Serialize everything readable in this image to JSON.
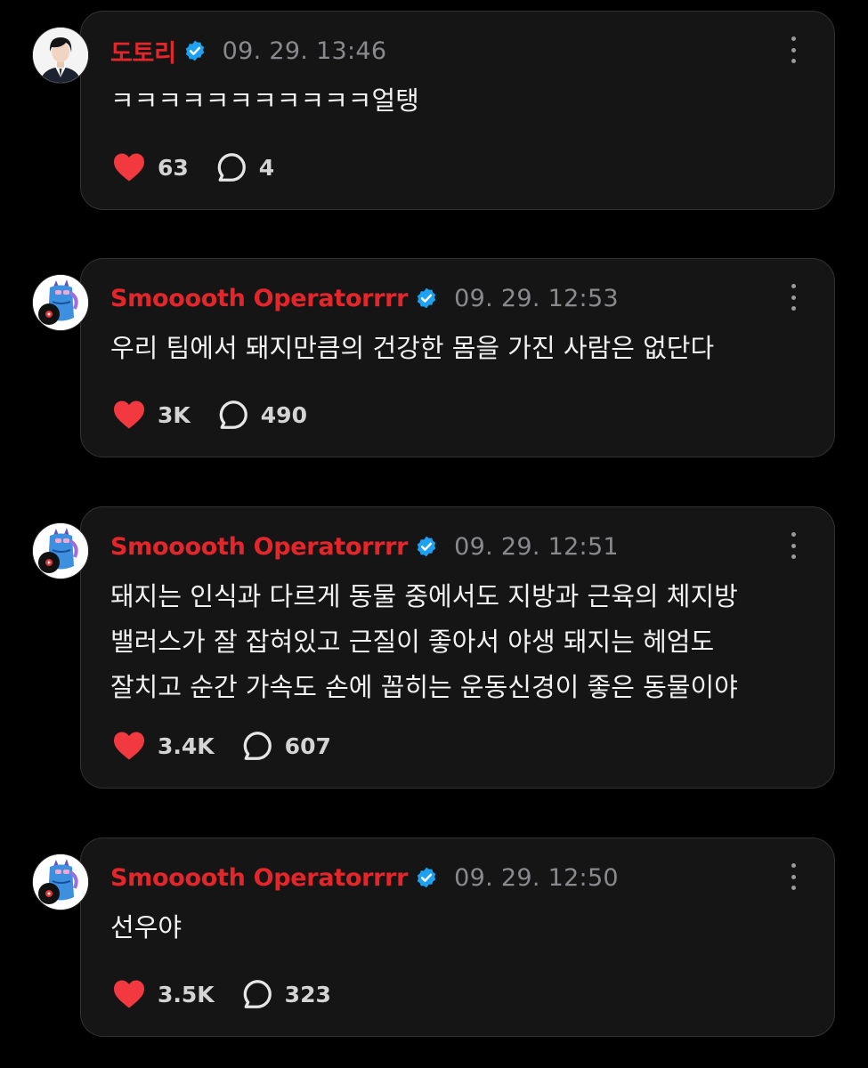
{
  "posts": [
    {
      "author": "도토리",
      "verified": true,
      "time": "09. 29. 13:46",
      "text": "ㅋㅋㅋㅋㅋㅋㅋㅋㅋㅋㅋ얼탱",
      "likes": "63",
      "replies": "4",
      "avatar_icon": "person-photo-avatar"
    },
    {
      "author": "Smooooth Operatorrrr",
      "verified": true,
      "time": "09. 29. 12:53",
      "text": "우리 팀에서 돼지만큼의 건강한 몸을 가진 사람은 없단다",
      "likes": "3K",
      "replies": "490",
      "avatar_icon": "blue-character-avatar"
    },
    {
      "author": "Smooooth Operatorrrr",
      "verified": true,
      "time": "09. 29. 12:51",
      "text": "돼지는 인식과 다르게 동물 중에서도 지방과 근육의 체지방\n밸러스가 잘 잡혀있고 근질이 좋아서 야생 돼지는 헤엄도\n잘치고 순간 가속도 손에 꼽히는 운동신경이 좋은 동물이야",
      "likes": "3.4K",
      "replies": "607",
      "avatar_icon": "blue-character-avatar"
    },
    {
      "author": "Smooooth Operatorrrr",
      "verified": true,
      "time": "09. 29. 12:50",
      "text": "선우야",
      "likes": "3.5K",
      "replies": "323",
      "avatar_icon": "blue-character-avatar"
    }
  ],
  "colors": {
    "background": "#000000",
    "card": "#151516",
    "author_name": "#e4262a",
    "heart": "#f2393f",
    "verified_badge": "#1da1f2",
    "timestamp": "#8a8a8e"
  }
}
